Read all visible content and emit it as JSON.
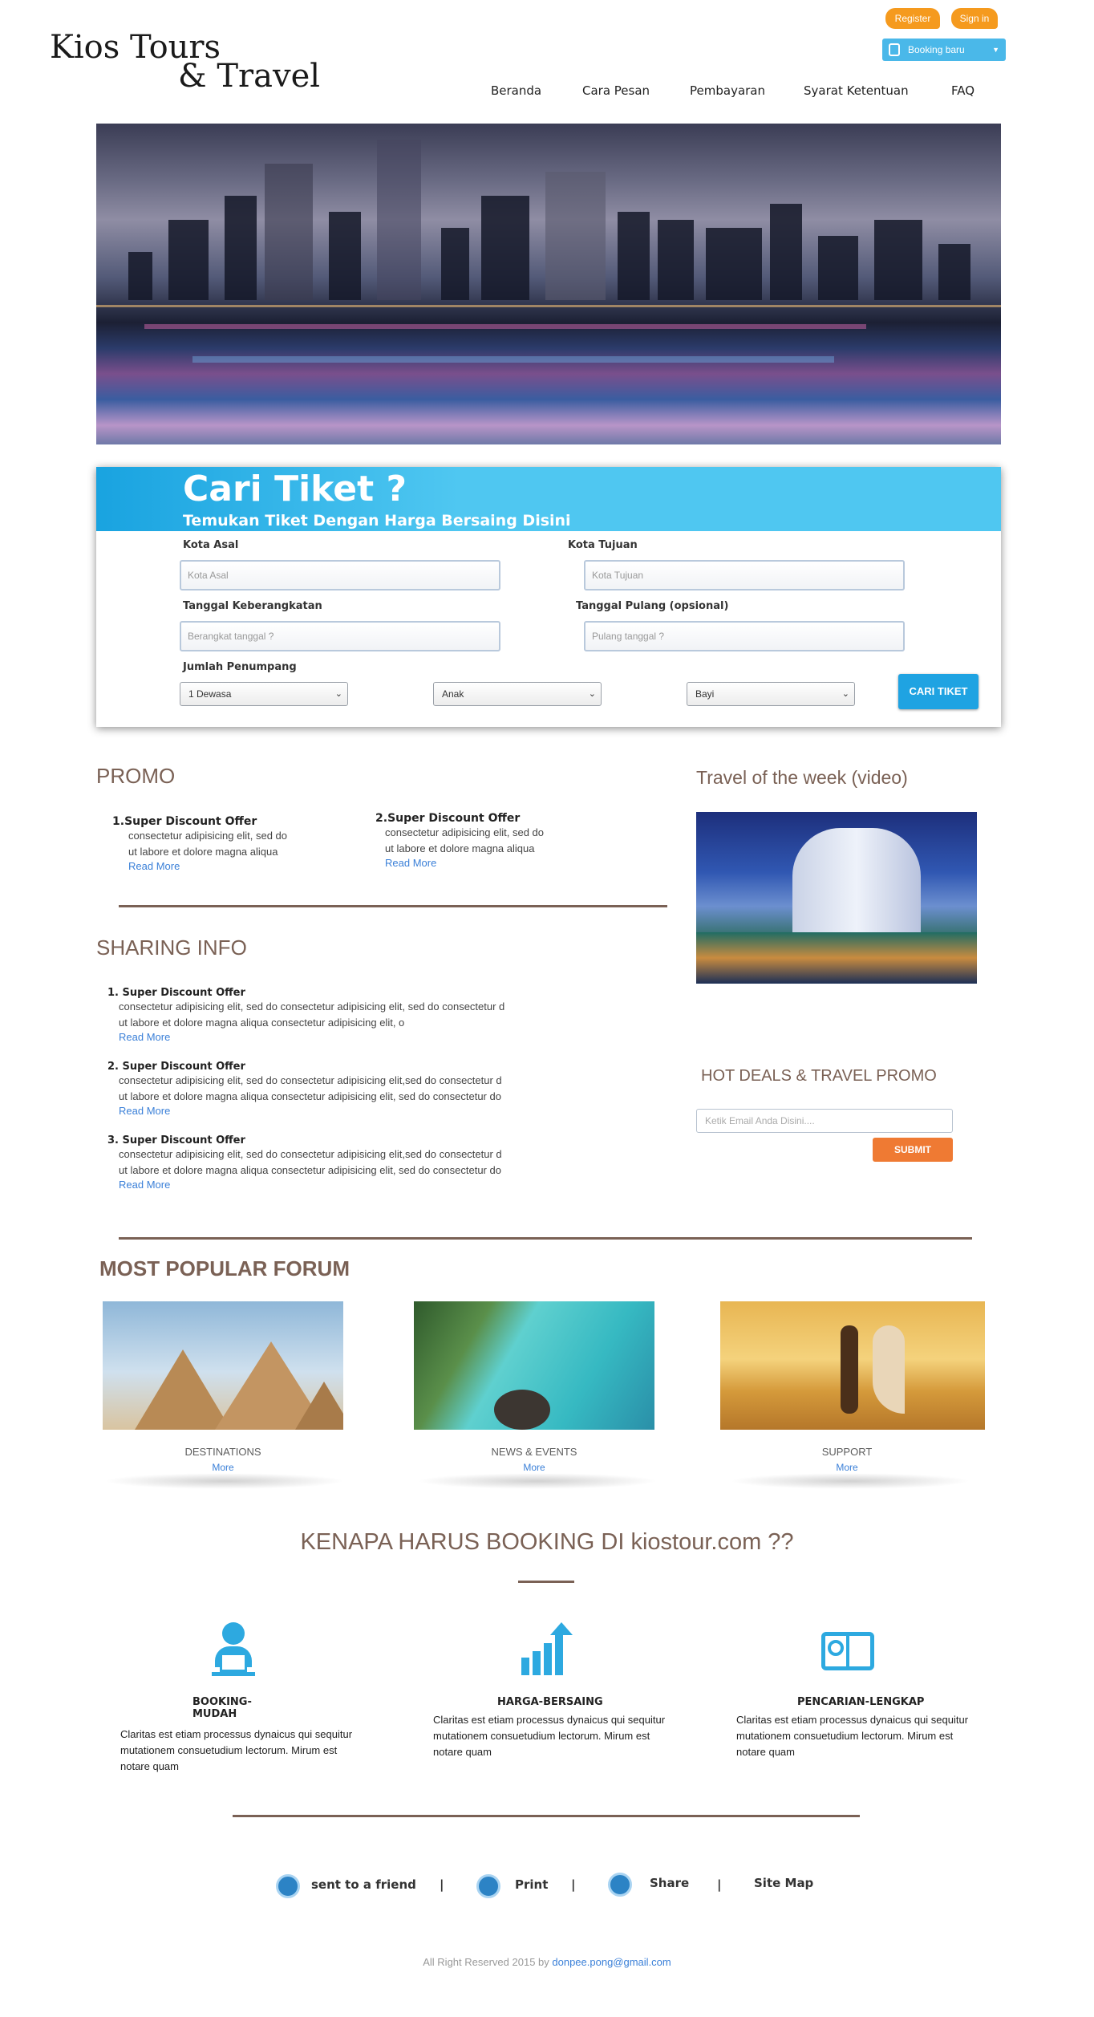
{
  "brand": {
    "line1": "Kios Tours",
    "line2": "& Travel"
  },
  "header": {
    "register_label": "Register",
    "signin_label": "Sign in",
    "booking_label": "Booking baru"
  },
  "nav": [
    "Beranda",
    "Cara Pesan",
    "Pembayaran",
    "Syarat Ketentuan",
    "FAQ"
  ],
  "search": {
    "title": "Cari Tiket ?",
    "subtitle": "Temukan Tiket Dengan Harga Bersaing Disini",
    "kota_asal_label": "Kota Asal",
    "kota_asal_placeholder": "Kota Asal",
    "kota_tujuan_label": "Kota Tujuan",
    "kota_tujuan_placeholder": "Kota Tujuan",
    "berangkat_label": "Tanggal Keberangkatan",
    "berangkat_placeholder": "Berangkat tanggal ?",
    "pulang_label": "Tanggal Pulang (opsional)",
    "pulang_placeholder": "Pulang tanggal ?",
    "penumpang_label": "Jumlah Penumpang",
    "dewasa": "1 Dewasa",
    "anak": "Anak",
    "bayi": "Bayi",
    "button": "CARI TIKET"
  },
  "promo": {
    "title": "PROMO",
    "items": [
      {
        "num": "1.",
        "title": "Super Discount Offer",
        "line1": "consectetur adipisicing elit, sed do",
        "line2": "ut labore et dolore magna aliqua",
        "link": "Read More"
      },
      {
        "num": "2.",
        "title": "Super Discount Offer",
        "line1": "consectetur adipisicing elit, sed do",
        "line2": "ut labore et dolore magna aliqua",
        "link": "Read More"
      }
    ]
  },
  "week": {
    "title": "Travel of the week  (video)"
  },
  "sharing": {
    "title": "SHARING INFO",
    "items": [
      {
        "num": "1.",
        "title": "Super Discount Offer",
        "line1": "consectetur adipisicing elit, sed do consectetur adipisicing elit, sed do consectetur d",
        "line2": "ut labore et dolore magna aliqua consectetur adipisicing elit, o",
        "link": "Read More"
      },
      {
        "num": "2.",
        "title": "Super Discount Offer",
        "line1": "consectetur adipisicing elit, sed do consectetur adipisicing elit,sed do consectetur d",
        "line2": "ut labore et dolore magna aliqua consectetur adipisicing elit, sed do consectetur do",
        "link": "Read More"
      },
      {
        "num": "3.",
        "title": "Super Discount Offer",
        "line1": "consectetur adipisicing elit, sed do consectetur adipisicing elit,sed do consectetur d",
        "line2": "ut labore et dolore magna aliqua consectetur adipisicing elit, sed do consectetur do",
        "link": "Read More"
      }
    ]
  },
  "hotdeals": {
    "title": "HOT DEALS & TRAVEL PROMO",
    "placeholder": "Ketik Email Anda Disini....",
    "button": "SUBMIT"
  },
  "forum": {
    "title": "MOST POPULAR FORUM",
    "items": [
      {
        "label": "DESTINATIONS",
        "more": "More"
      },
      {
        "label": "NEWS & EVENTS",
        "more": "More"
      },
      {
        "label": "SUPPORT",
        "more": "More"
      }
    ]
  },
  "why": {
    "title": "KENAPA HARUS BOOKING DI kiostour.com ??",
    "items": [
      {
        "h1": "BOOKING-",
        "h2": "MUDAH",
        "p1": "Claritas est etiam processus dynaicus qui sequitur",
        "p2": "mutationem consuetudium lectorum. Mirum est",
        "p3": "notare quam"
      },
      {
        "h1": "HARGA-BERSAING",
        "h2": "",
        "p1": "Claritas est etiam processus dynaicus qui sequitur",
        "p2": "mutationem consuetudium lectorum. Mirum est",
        "p3": "notare quam"
      },
      {
        "h1": "PENCARIAN-LENGKAP",
        "h2": "",
        "p1": "Claritas est etiam processus dynaicus qui sequitur",
        "p2": "mutationem consuetudium lectorum. Mirum est",
        "p3": "notare quam"
      }
    ]
  },
  "footer": {
    "friend": "sent to a friend",
    "print": "Print",
    "share": "Share",
    "sitemap": "Site Map",
    "sep": "|",
    "copy": "All Right Reserved 2015 by ",
    "email": "donpee.pong@gmail.com"
  },
  "colors": {
    "accent": "#4ab8e9",
    "brown": "#7a6155",
    "orange": "#f59a1e",
    "submit": "#ef7a33",
    "link": "#3b80d8"
  }
}
